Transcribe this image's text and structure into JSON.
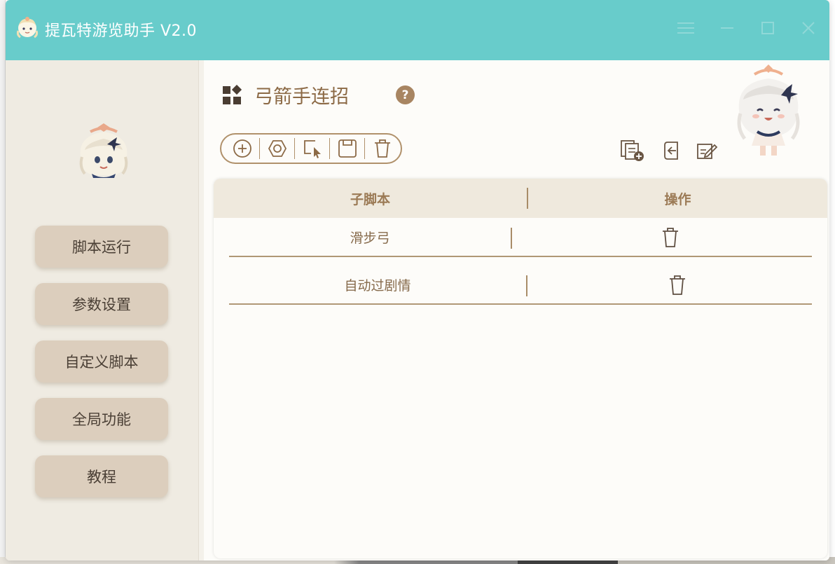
{
  "window": {
    "title": "提瓦特游览助手 V2.0",
    "colors": {
      "titlebar": "#68cccb",
      "sidebar": "#efebe2",
      "nav_button": "#dccebd",
      "accent_brown": "#a88562",
      "content_bg": "#fdfcf9"
    },
    "controls": {
      "menu_icon": "hamburger-menu-icon",
      "minimize_icon": "minimize-icon",
      "maximize_icon": "maximize-icon",
      "close_icon": "close-icon"
    }
  },
  "sidebar": {
    "avatar_icon": "paimon-avatar",
    "items": [
      {
        "label": "脚本运行"
      },
      {
        "label": "参数设置"
      },
      {
        "label": "自定义脚本"
      },
      {
        "label": "全局功能"
      },
      {
        "label": "教程"
      }
    ]
  },
  "main": {
    "page_title": "弓箭手连招",
    "page_icon": "grid-widgets-icon",
    "help_label": "?",
    "toolbar": [
      {
        "icon": "add-circle-icon"
      },
      {
        "icon": "settings-hex-icon"
      },
      {
        "icon": "select-cursor-icon"
      },
      {
        "icon": "save-icon"
      },
      {
        "icon": "trash-icon"
      }
    ],
    "right_tools": [
      {
        "icon": "copy-add-icon"
      },
      {
        "icon": "import-icon"
      },
      {
        "icon": "edit-export-icon"
      }
    ]
  },
  "table": {
    "headers": [
      "子脚本",
      "操作"
    ],
    "rows": [
      {
        "name": "滑步弓",
        "action_icon": "trash-icon"
      },
      {
        "name": "自动过剧情",
        "action_icon": "trash-icon"
      }
    ]
  }
}
